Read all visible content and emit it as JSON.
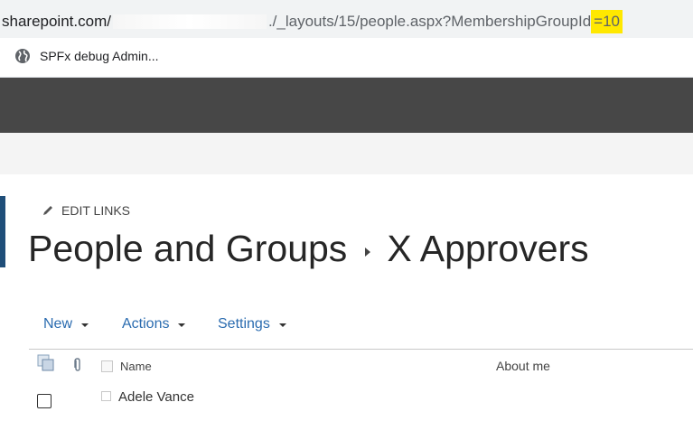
{
  "browser": {
    "url_host": "sharepoint.com/",
    "url_path": "./_layouts/15/people.aspx?MembershipGroupId",
    "url_highlight": "=10",
    "highlight_color": "#ffe800",
    "bookmark_icon": "globe-icon",
    "bookmark_label": "SPFx debug Admin..."
  },
  "suite_bar": {
    "color": "#474747"
  },
  "page": {
    "edit_links_icon": "pencil-icon",
    "edit_links_label": "EDIT LINKS",
    "title_parent": "People and Groups",
    "title_separator_icon": "breadcrumb-arrow-icon",
    "title_current": "X Approvers",
    "accent_color": "#1f4e79"
  },
  "toolbar": {
    "new_label": "New",
    "actions_label": "Actions",
    "settings_label": "Settings",
    "link_color": "#2b6cb0"
  },
  "list": {
    "select_all_icon": "select-all-icon",
    "attachment_icon": "paperclip-icon",
    "columns": [
      "Name",
      "About me"
    ],
    "rows": [
      {
        "name": "Adele Vance",
        "about": ""
      }
    ]
  }
}
